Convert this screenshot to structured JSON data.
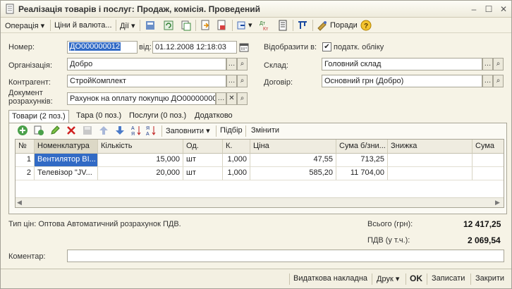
{
  "window": {
    "title": "Реалізація товарів і послуг: Продаж, комісія. Проведений"
  },
  "toolbar": {
    "operation": "Операція",
    "prices": "Ціни й валюта...",
    "actions": "Дії",
    "advice": "Поради"
  },
  "form": {
    "number_label": "Номер:",
    "number": "ДО000000012",
    "date_label": "від:",
    "date": "01.12.2008 12:18:03",
    "reflect_label": "Відобразити в:",
    "tax_label": "податк. облікy",
    "org_label": "Організація:",
    "org": "Добро",
    "warehouse_label": "Склад:",
    "warehouse": "Головний склад",
    "contractor_label": "Контрагент:",
    "contractor": "СтройКомплект",
    "contract_label": "Договір:",
    "contract": "Основний грн (Добро)",
    "doc_label_1": "Документ",
    "doc_label_2": "розрахунків:",
    "doc": "Рахунок на оплату покупцю ДО00000000"
  },
  "tabs": [
    "Товари (2 поз.)",
    "Тара (0 поз.)",
    "Послуги (0 поз.)",
    "Додатково"
  ],
  "grid_toolbar": {
    "fill": "Заповнити",
    "select": "Підбір",
    "change": "Змінити"
  },
  "grid": {
    "headers": [
      "№",
      "Номенклатура",
      "Кількість",
      "Од.",
      "К.",
      "Ціна",
      "Сума б/зни...",
      "Знижка",
      "Сума"
    ],
    "rows": [
      [
        "1",
        "Вентилятор BI...",
        "15,000",
        "шт",
        "1,000",
        "47,55",
        "713,25",
        "",
        ""
      ],
      [
        "2",
        "Телевізор \"JV...",
        "20,000",
        "шт",
        "1,000",
        "585,20",
        "11 704,00",
        "",
        ""
      ]
    ]
  },
  "totals": {
    "price_type": "Тип цін: Оптова Автоматичний розрахунок ПДВ.",
    "total_label": "Всього (грн):",
    "total": "12 417,25",
    "vat_label": "ПДВ (у т.ч.):",
    "vat": "2 069,54"
  },
  "comment": {
    "label": "Коментар:",
    "value": ""
  },
  "bottom": {
    "invoice": "Видаткова накладна",
    "print": "Друк",
    "ok": "OK",
    "save": "Записати",
    "close": "Закрити"
  }
}
